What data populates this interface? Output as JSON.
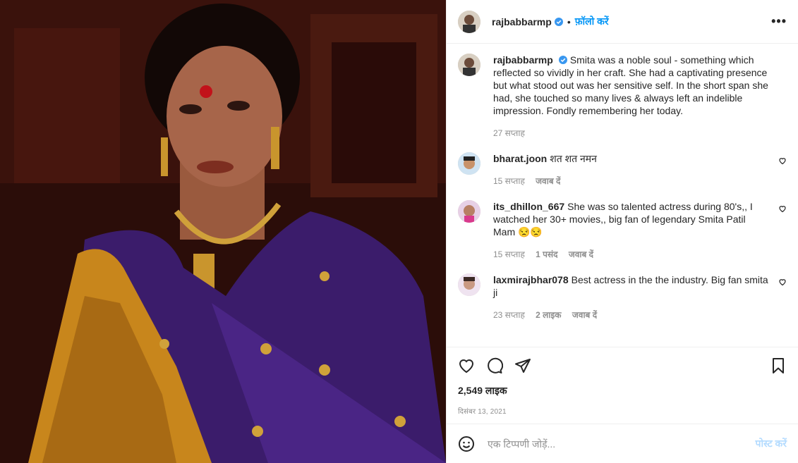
{
  "post": {
    "username": "rajbabbarmp",
    "follow_label": "फ़ॉलो करें",
    "separator": "•",
    "more_label": "•••",
    "caption": "Smita was a noble soul - something which reflected so vividly in her craft. She had a captivating presence but what stood out was her sensitive self. In the short span she had, she touched so many lives & always left an indelible impression. Fondly remembering her today.",
    "caption_time": "27 सप्ताह",
    "likes": "2,549 लाइक",
    "date": "दिसंबर 13, 2021"
  },
  "comments": [
    {
      "username": "bharat.joon",
      "text": "शत शत नमन",
      "time": "15 सप्ताह",
      "likes": "",
      "reply": "जवाब दें"
    },
    {
      "username": "its_dhillon_667",
      "text": "She was so talented actress during 80's,, I watched her 30+ movies,, big fan of legendary Smita Patil Mam 😒😒",
      "time": "15 सप्ताह",
      "likes": "1 पसंद",
      "reply": "जवाब दें"
    },
    {
      "username": "laxmirajbhar078",
      "text": "Best actress in the the industry. Big fan smita ji",
      "time": "23 सप्ताह",
      "likes": "2 लाइक",
      "reply": "जवाब दें"
    }
  ],
  "add_comment": {
    "placeholder": "एक टिप्पणी जोड़ें...",
    "post_label": "पोस्ट करें"
  },
  "colors": {
    "accent": "#0095f6",
    "post_disabled": "#b3dbff",
    "verified": "#3897f0"
  },
  "icons": [
    "verified-icon",
    "more-options-icon",
    "heart-icon",
    "comment-icon",
    "share-icon",
    "bookmark-icon",
    "emoji-icon"
  ]
}
